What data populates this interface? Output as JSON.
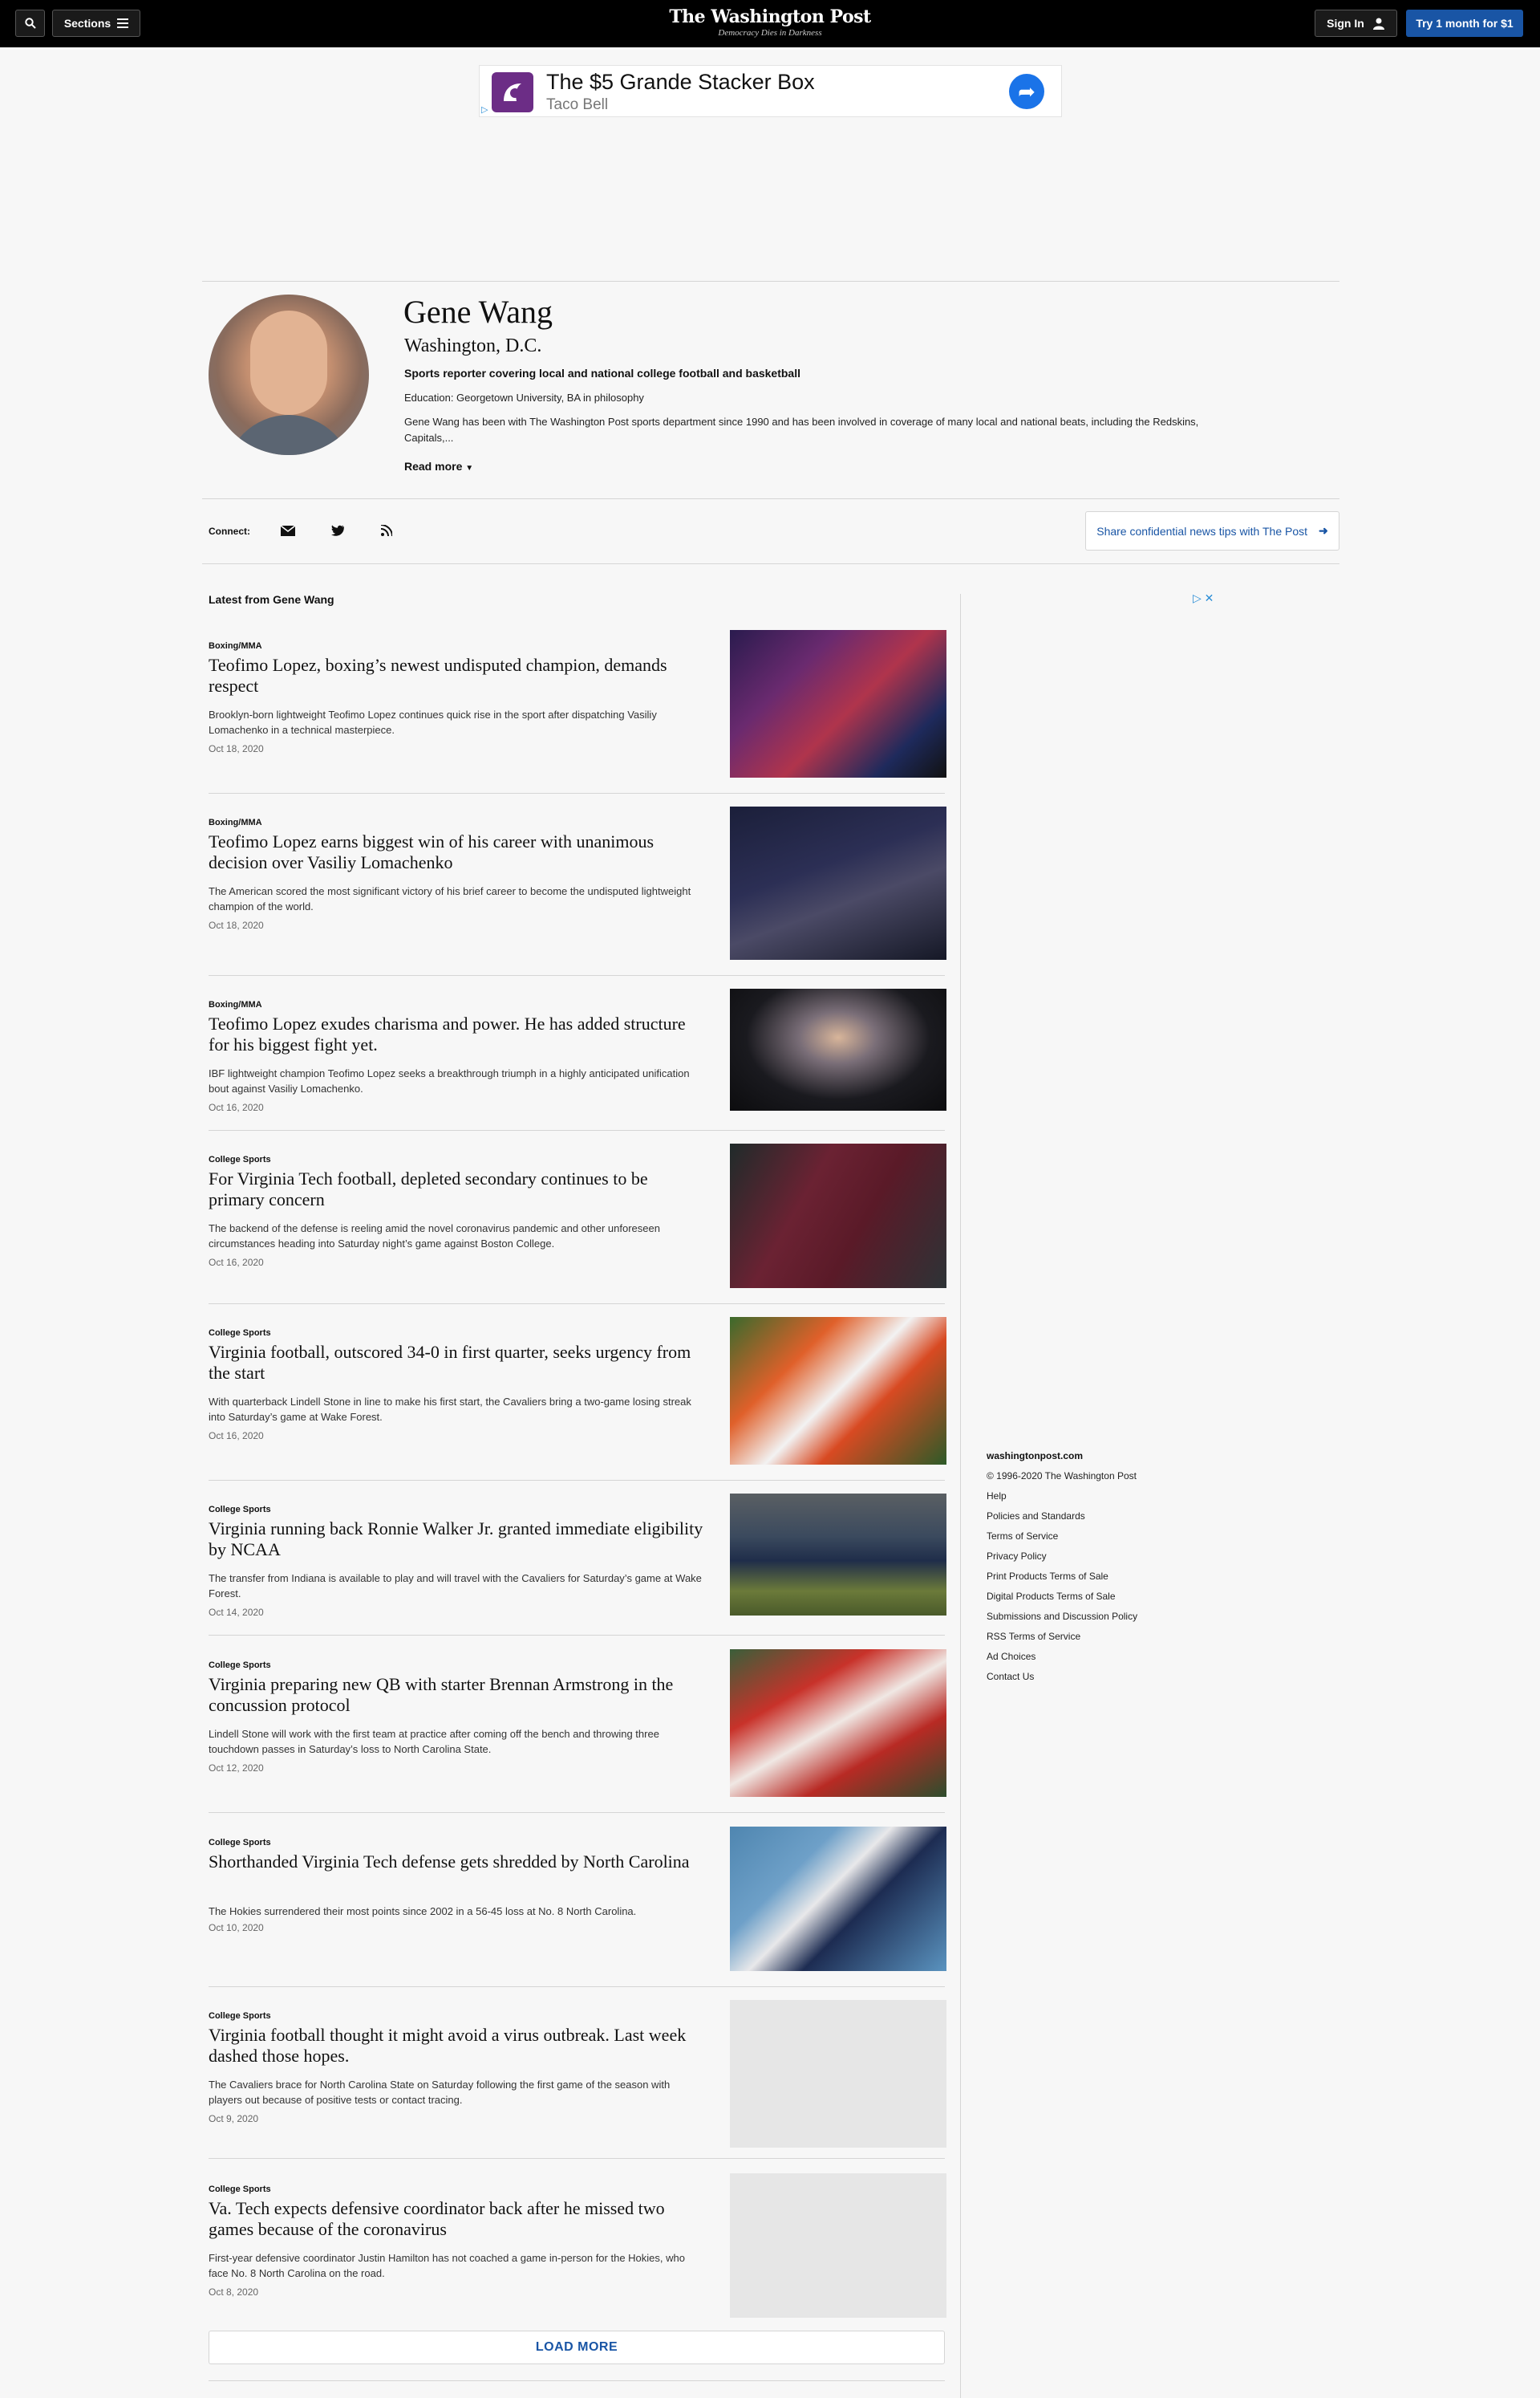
{
  "header": {
    "sections_label": "Sections",
    "logo_name": "The Washington Post",
    "logo_tagline": "Democracy Dies in Darkness",
    "signin_label": "Sign In",
    "subscribe_label": "Try 1 month for $1"
  },
  "ad": {
    "title": "The $5 Grande Stacker Box",
    "advertiser": "Taco Bell"
  },
  "profile": {
    "name": "Gene Wang",
    "location": "Washington, D.C.",
    "title": "Sports reporter covering local and national college football and basketball",
    "education": "Education: Georgetown University, BA in philosophy",
    "bio": "Gene Wang has been with The Washington Post sports department since 1990 and has been involved in coverage of many local and national beats, including the Redskins, Capitals,...",
    "read_more": "Read more"
  },
  "connect": {
    "label": "Connect:",
    "icons": [
      "email-icon",
      "twitter-icon",
      "rss-icon"
    ],
    "tips_label": "Share confidential news tips with The Post"
  },
  "latest": {
    "heading": "Latest from Gene Wang",
    "articles": [
      {
        "section": "Boxing/MMA",
        "headline": "Teofimo Lopez, boxing’s newest undisputed champion, demands respect",
        "blurb": "Brooklyn-born lightweight Teofimo Lopez continues quick rise in the sport after dispatching Vasiliy Lomachenko in a technical masterpiece.",
        "date": "Oct 18, 2020"
      },
      {
        "section": "Boxing/MMA",
        "headline": "Teofimo Lopez earns biggest win of his career with unanimous decision over Vasiliy Lomachenko",
        "blurb": "The American scored the most significant victory of his brief career to become the undisputed lightweight champion of the world.",
        "date": "Oct 18, 2020"
      },
      {
        "section": "Boxing/MMA",
        "headline": "Teofimo Lopez exudes charisma and power. He has added structure for his biggest fight yet.",
        "blurb": "IBF lightweight champion Teofimo Lopez seeks a breakthrough triumph in a highly anticipated unification bout against Vasiliy Lomachenko.",
        "date": "Oct 16, 2020"
      },
      {
        "section": "College Sports",
        "headline": "For Virginia Tech football, depleted secondary continues to be primary concern",
        "blurb": "The backend of the defense is reeling amid the novel coronavirus pandemic and other unforeseen circumstances heading into Saturday night’s game against Boston College.",
        "date": "Oct 16, 2020"
      },
      {
        "section": "College Sports",
        "headline": "Virginia football, outscored 34-0 in first quarter, seeks urgency from the start",
        "blurb": "With quarterback Lindell Stone in line to make his first start, the Cavaliers bring a two-game losing streak into Saturday’s game at Wake Forest.",
        "date": "Oct 16, 2020"
      },
      {
        "section": "College Sports",
        "headline": "Virginia running back Ronnie Walker Jr. granted immediate eligibility by NCAA",
        "blurb": "The transfer from Indiana is available to play and will travel with the Cavaliers for Saturday’s game at Wake Forest.",
        "date": "Oct 14, 2020"
      },
      {
        "section": "College Sports",
        "headline": "Virginia preparing new QB with starter Brennan Armstrong in the concussion protocol",
        "blurb": "Lindell Stone will work with the first team at practice after coming off the bench and throwing three touchdown passes in Saturday’s loss to North Carolina State.",
        "date": "Oct 12, 2020"
      },
      {
        "section": "College Sports",
        "headline": "Shorthanded Virginia Tech defense gets shredded by North Carolina",
        "blurb": "The Hokies surrendered their most points since 2002 in a 56-45 loss at No. 8 North Carolina.",
        "date": "Oct 10, 2020"
      },
      {
        "section": "College Sports",
        "headline": "Virginia football thought it might avoid a virus outbreak. Last week dashed those hopes.",
        "blurb": "The Cavaliers brace for North Carolina State on Saturday following the first game of the season with players out because of positive tests or contact tracing.",
        "date": "Oct 9, 2020"
      },
      {
        "section": "College Sports",
        "headline": "Va. Tech expects defensive coordinator back after he missed two games because of the coronavirus",
        "blurb": "First-year defensive coordinator Justin Hamilton has not coached a game in-person for the Hokies, who face No. 8 North Carolina on the road.",
        "date": "Oct 8, 2020"
      }
    ],
    "load_more": "LOAD MORE"
  },
  "footer": {
    "brand": "washingtonpost.com",
    "copyright": "© 1996-2020 The Washington Post",
    "links": [
      "Help",
      "Policies and Standards",
      "Terms of Service",
      "Privacy Policy",
      "Print Products Terms of Sale",
      "Digital Products Terms of Sale",
      "Submissions and Discussion Policy",
      "RSS Terms of Service",
      "Ad Choices",
      "Contact Us"
    ]
  },
  "colors": {
    "accent": "#1955a5",
    "topbar": "#000000",
    "background": "#f7f7f7"
  }
}
